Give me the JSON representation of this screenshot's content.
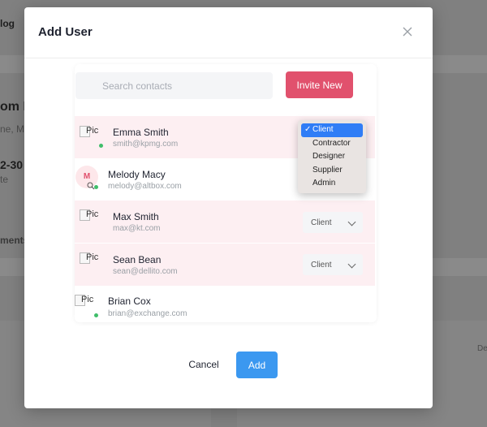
{
  "background": {
    "partial_title": "log",
    "partial_heading": "om F",
    "partial_sub": "ne, M",
    "partial_date": "2-30",
    "partial_note": "te",
    "partial_section": "ments",
    "partial_right": "De"
  },
  "modal": {
    "title": "Add User",
    "close_icon": "close-icon",
    "search_placeholder": "Search contacts",
    "invite_label": "Invite New",
    "cancel_label": "Cancel",
    "add_label": "Add"
  },
  "contacts": [
    {
      "name": "Emma Smith",
      "email": "smith@kpmg.com",
      "avatar_alt": "Pic",
      "online": true,
      "role": "Client",
      "highlighted": true
    },
    {
      "name": "Melody Macy",
      "email": "melody@altbox.com",
      "avatar_initial": "M",
      "online": true,
      "highlighted": false
    },
    {
      "name": "Max Smith",
      "email": "max@kt.com",
      "avatar_alt": "Pic",
      "online": false,
      "role": "Client",
      "highlighted": true
    },
    {
      "name": "Sean Bean",
      "email": "sean@dellito.com",
      "avatar_alt": "Pic",
      "online": false,
      "role": "Client",
      "highlighted": true
    },
    {
      "name": "Brian Cox",
      "email": "brian@exchange.com",
      "avatar_alt": "Pic",
      "online": true,
      "highlighted": false
    }
  ],
  "role_dropdown": {
    "options": [
      "Client",
      "Contractor",
      "Designer",
      "Supplier",
      "Admin"
    ],
    "selected": "Client",
    "check_icon": "check-icon"
  }
}
